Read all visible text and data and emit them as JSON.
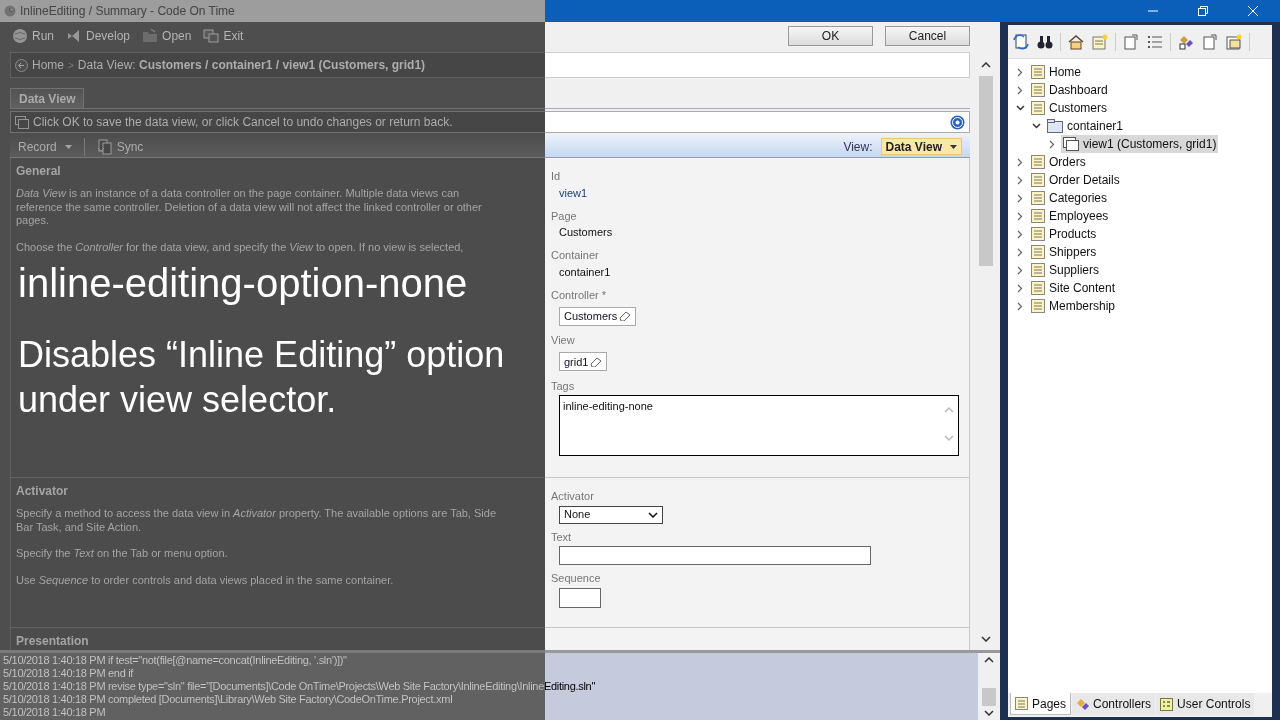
{
  "window": {
    "title": "InlineEditing / Summary - Code On Time"
  },
  "toolbar": [
    {
      "label": "Run",
      "kind": "globe"
    },
    {
      "label": "Develop",
      "kind": "vs"
    },
    {
      "label": "Open",
      "kind": "folder"
    },
    {
      "label": "Exit",
      "kind": "exit"
    }
  ],
  "dialog_buttons": [
    "OK",
    "Cancel"
  ],
  "breadcrumb": {
    "home": "Home",
    "separator": ">",
    "path": "Data View: **Customers / container1 / view1 (Customers, grid1)**"
  },
  "tabs": [
    {
      "label": "Data View",
      "selected": true
    }
  ],
  "hint": "Click OK to save the data view, or click Cancel to undo changes or return back.",
  "action_bar": {
    "items": [
      {
        "label": "Record",
        "kind": "menu"
      },
      {
        "label": "Sync",
        "kind": "button"
      }
    ],
    "view_label": "View:",
    "view_value": "Data View"
  },
  "sections": [
    {
      "title": "General",
      "paragraphs": [
        "*Data View* is an instance of a data controller on the page container. Multiple data views can reference the same controller. Deletion of a data view will not affect the linked controller or other pages.",
        "Choose the *Controller* for the data view, and specify the *View* to open. If no view is selected,"
      ],
      "fields": [
        {
          "label": "Id",
          "value": "view1",
          "kind": "link"
        },
        {
          "label": "Page",
          "value": "Customers",
          "kind": "text"
        },
        {
          "label": "Container",
          "value": "container1",
          "kind": "text"
        },
        {
          "label": "Controller *",
          "value": "Customers",
          "kind": "lookup"
        },
        {
          "label": "View",
          "value": "grid1",
          "kind": "lookup"
        },
        {
          "label": "Tags",
          "value": "inline-editing-none",
          "kind": "textarea"
        }
      ]
    },
    {
      "title": "Activator",
      "paragraphs": [
        "Specify a method to access the data view in *Activator* property. The available options are Tab, Side Bar Task, and Site Action.",
        "Specify the *Text* on the Tab or menu option.",
        "Use *Sequence* to order controls and data views placed in the same container."
      ],
      "fields": [
        {
          "label": "Activator",
          "value": "None",
          "kind": "select"
        },
        {
          "label": "Text",
          "kind": "input"
        },
        {
          "label": "Sequence",
          "kind": "small-input"
        }
      ]
    },
    {
      "title": "Presentation"
    }
  ],
  "log": [
    "5/10/2018 1:40:18 PM if test=\"not(file[@name=concat(InlineEditing, '.sln')])\"",
    "5/10/2018 1:40:18 PM end if",
    "5/10/2018 1:40:18 PM revise type=\"sln\" file=\"[Documents]\\Code OnTime\\Projects\\Web Site Factory\\InlineEditing\\InlineEditing.sln\"",
    "5/10/2018 1:40:18 PM completed [Documents]\\Library\\Web Site Factory\\CodeOnTime.Project.xml",
    "5/10/2018 1:40:18 PM"
  ],
  "caption": {
    "title": "inline-editing-option-none",
    "text": "Disables “Inline Editing” option under view selector."
  },
  "tree": [
    {
      "label": "Home",
      "kind": "page",
      "expanded": false,
      "selected": false
    },
    {
      "label": "Dashboard",
      "kind": "page",
      "expanded": false,
      "selected": false
    },
    {
      "label": "Customers",
      "kind": "page",
      "expanded": true,
      "selected": false,
      "children": [
        {
          "label": "container1",
          "kind": "container",
          "expanded": true,
          "selected": false,
          "children": [
            {
              "label": "view1 (Customers, grid1)",
              "kind": "view",
              "expanded": false,
              "selected": true
            }
          ]
        }
      ]
    },
    {
      "label": "Orders",
      "kind": "page",
      "expanded": false,
      "selected": false
    },
    {
      "label": "Order Details",
      "kind": "page",
      "expanded": false,
      "selected": false
    },
    {
      "label": "Categories",
      "kind": "page",
      "expanded": false,
      "selected": false
    },
    {
      "label": "Employees",
      "kind": "page",
      "expanded": false,
      "selected": false
    },
    {
      "label": "Products",
      "kind": "page",
      "expanded": false,
      "selected": false
    },
    {
      "label": "Shippers",
      "kind": "page",
      "expanded": false,
      "selected": false
    },
    {
      "label": "Suppliers",
      "kind": "page",
      "expanded": false,
      "selected": false
    },
    {
      "label": "Site Content",
      "kind": "page",
      "expanded": false,
      "selected": false
    },
    {
      "label": "Membership",
      "kind": "page",
      "expanded": false,
      "selected": false
    }
  ],
  "bottom_tabs": [
    {
      "label": "Pages",
      "selected": true
    },
    {
      "label": "Controllers",
      "selected": false
    },
    {
      "label": "User Controls",
      "selected": false
    }
  ]
}
